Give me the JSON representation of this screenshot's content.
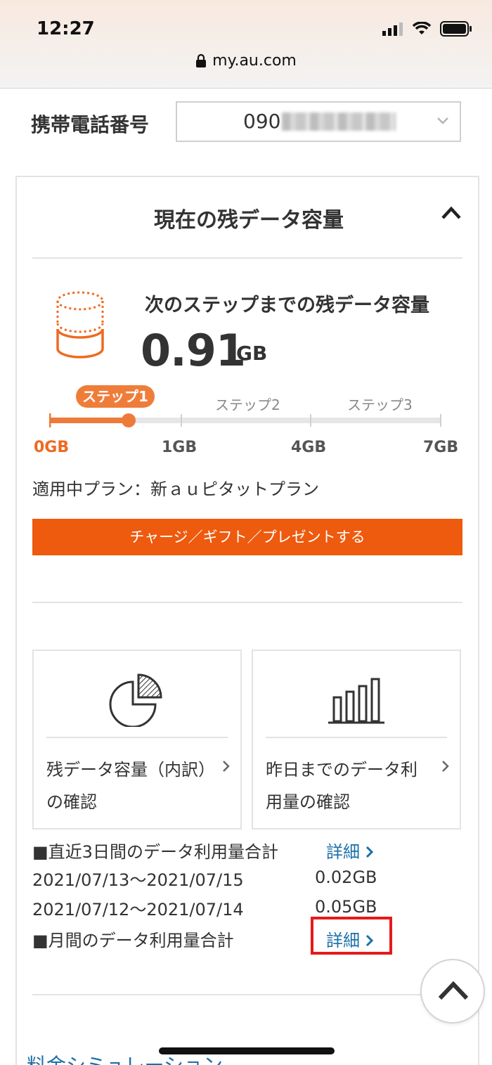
{
  "status_bar": {
    "time": "12:27",
    "url": "my.au.com"
  },
  "phone": {
    "label": "携帯電話番号",
    "value_prefix": "090"
  },
  "panel": {
    "title": "現在の残データ容量",
    "step_title": "次のステップまでの残データ容量",
    "remaining_value": "0.91",
    "remaining_unit": "GB",
    "steps": [
      "ステップ1",
      "ステップ2",
      "ステップ3"
    ],
    "gauge_ticks": [
      "0GB",
      "1GB",
      "4GB",
      "7GB"
    ],
    "gauge_progress_in_step1": 0.91,
    "plan": "適用中プラン：新ａｕピタットプラン",
    "charge_button": "チャージ／ギフト／プレゼントする",
    "accent_color": "#ee5a0e"
  },
  "tiles": [
    {
      "label": "残データ容量（内訳）の確認",
      "icon": "pie-chart-icon"
    },
    {
      "label": "昨日までのデータ利用量の確認",
      "icon": "bar-chart-icon"
    }
  ],
  "usage": {
    "recent_heading": "■直近3日間のデータ利用量合計",
    "detail_label": "詳細",
    "rows": [
      {
        "period": "2021/07/13〜2021/07/15",
        "amount": "0.02GB"
      },
      {
        "period": "2021/07/12〜2021/07/14",
        "amount": "0.05GB"
      }
    ],
    "monthly_heading": "■月間のデータ利用量合計"
  },
  "footer": {
    "sim_link": "料金シミュレーション"
  }
}
